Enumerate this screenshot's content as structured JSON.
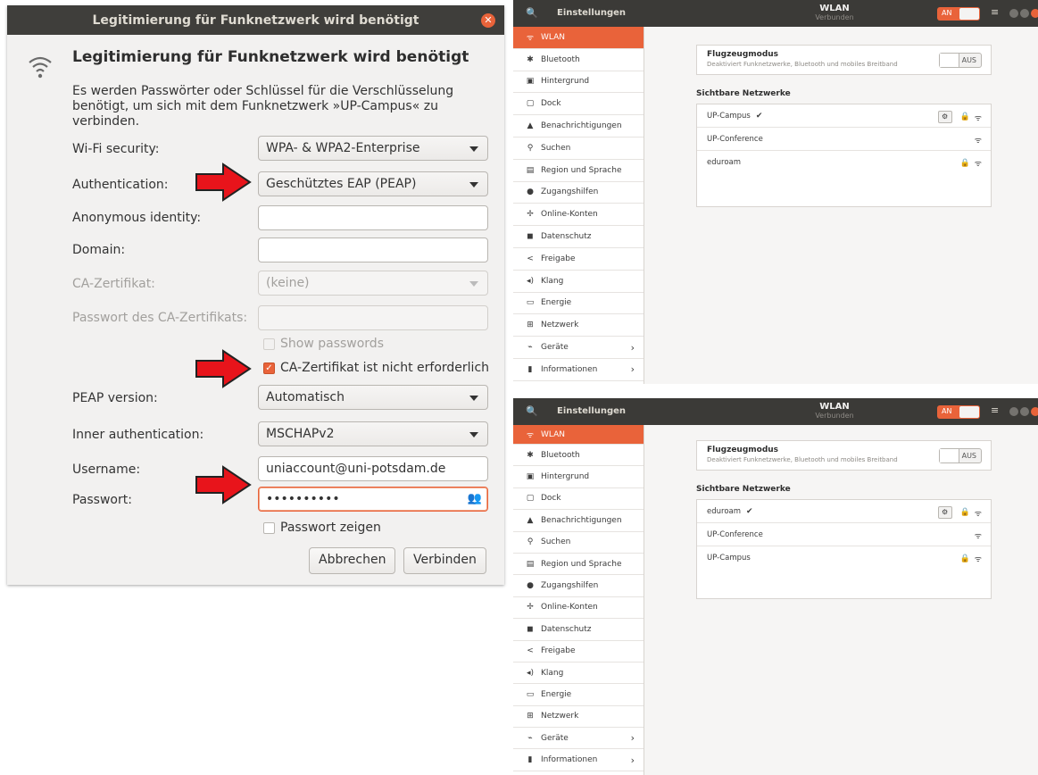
{
  "dialog": {
    "window_title": "Legitimierung für Funknetzwerk wird benötigt",
    "heading": "Legitimierung für Funknetzwerk wird benötigt",
    "description": "Es werden Passwörter oder Schlüssel für die Verschlüsselung benötigt, um sich mit dem Funknetzwerk »UP-Campus« zu verbinden.",
    "fields": {
      "wifi_security_label": "Wi-Fi security:",
      "wifi_security_value": "WPA- & WPA2-Enterprise",
      "authentication_label": "Authentication:",
      "authentication_value": "Geschütztes EAP (PEAP)",
      "anonymous_identity_label": "Anonymous identity:",
      "anonymous_identity_value": "",
      "domain_label": "Domain:",
      "domain_value": "",
      "ca_cert_label": "CA-Zertifikat:",
      "ca_cert_value": "(keine)",
      "ca_cert_password_label": "Passwort des CA-Zertifikats:",
      "ca_cert_password_value": "",
      "show_passwords_label": "Show passwords",
      "ca_not_required_label": "CA-Zertifikat ist nicht erforderlich",
      "peap_version_label": "PEAP version:",
      "peap_version_value": "Automatisch",
      "inner_auth_label": "Inner authentication:",
      "inner_auth_value": "MSCHAPv2",
      "username_label": "Username:",
      "username_value": "uniaccount@uni-potsdam.de",
      "password_label": "Passwort:",
      "password_value": "••••••••••",
      "show_password_label": "Passwort zeigen"
    },
    "ca_not_required_checked": true,
    "buttons": {
      "cancel": "Abbrechen",
      "connect": "Verbinden"
    }
  },
  "settings_top": {
    "header": {
      "app_title": "Einstellungen",
      "page_title": "WLAN",
      "page_status": "Verbunden",
      "toggle_label": "AN"
    },
    "sidebar": [
      {
        "label": "WLAN",
        "icon": "wifi-icon",
        "glyph": "ὭC"
      },
      {
        "label": "Bluetooth",
        "icon": "bluetooth-icon"
      },
      {
        "label": "Hintergrund",
        "icon": "background-icon"
      },
      {
        "label": "Dock",
        "icon": "dock-icon"
      },
      {
        "label": "Benachrichtigungen",
        "icon": "bell-icon"
      },
      {
        "label": "Suchen",
        "icon": "search-icon"
      },
      {
        "label": "Region und Sprache",
        "icon": "region-icon"
      },
      {
        "label": "Zugangshilfen",
        "icon": "accessibility-icon"
      },
      {
        "label": "Online-Konten",
        "icon": "online-accounts-icon"
      },
      {
        "label": "Datenschutz",
        "icon": "privacy-icon"
      },
      {
        "label": "Freigabe",
        "icon": "share-icon"
      },
      {
        "label": "Klang",
        "icon": "sound-icon"
      },
      {
        "label": "Energie",
        "icon": "power-icon"
      },
      {
        "label": "Netzwerk",
        "icon": "network-icon"
      },
      {
        "label": "Geräte",
        "icon": "devices-icon"
      },
      {
        "label": "Informationen",
        "icon": "info-icon"
      }
    ],
    "airplane": {
      "title": "Flugzeugmodus",
      "description": "Deaktiviert Funknetzwerke, Bluetooth und mobiles Breitband",
      "switch_label": "AUS"
    },
    "visible_networks_heading": "Sichtbare Netzwerke",
    "networks": [
      {
        "name": "UP-Campus",
        "connected": true,
        "locked": true
      },
      {
        "name": "UP-Conference",
        "connected": false,
        "locked": false
      },
      {
        "name": "eduroam",
        "connected": false,
        "locked": true
      }
    ]
  },
  "settings_bottom": {
    "header": {
      "app_title": "Einstellungen",
      "page_title": "WLAN",
      "page_status": "Verbunden",
      "toggle_label": "AN"
    },
    "sidebar": [
      {
        "label": "WLAN"
      },
      {
        "label": "Bluetooth"
      },
      {
        "label": "Hintergrund"
      },
      {
        "label": "Dock"
      },
      {
        "label": "Benachrichtigungen"
      },
      {
        "label": "Suchen"
      },
      {
        "label": "Region und Sprache"
      },
      {
        "label": "Zugangshilfen"
      },
      {
        "label": "Online-Konten"
      },
      {
        "label": "Datenschutz"
      },
      {
        "label": "Freigabe"
      },
      {
        "label": "Klang"
      },
      {
        "label": "Energie"
      },
      {
        "label": "Netzwerk"
      },
      {
        "label": "Geräte"
      },
      {
        "label": "Informationen"
      }
    ],
    "airplane": {
      "title": "Flugzeugmodus",
      "description": "Deaktiviert Funknetzwerke, Bluetooth und mobiles Breitband",
      "switch_label": "AUS"
    },
    "visible_networks_heading": "Sichtbare Netzwerke",
    "networks": [
      {
        "name": "eduroam",
        "connected": true,
        "locked": true
      },
      {
        "name": "UP-Conference",
        "connected": false,
        "locked": false
      },
      {
        "name": "UP-Campus",
        "connected": false,
        "locked": true
      }
    ]
  },
  "colors": {
    "accent": "#e9633a",
    "arrow_red": "#e8141b",
    "header_dark": "#3b3a37"
  }
}
